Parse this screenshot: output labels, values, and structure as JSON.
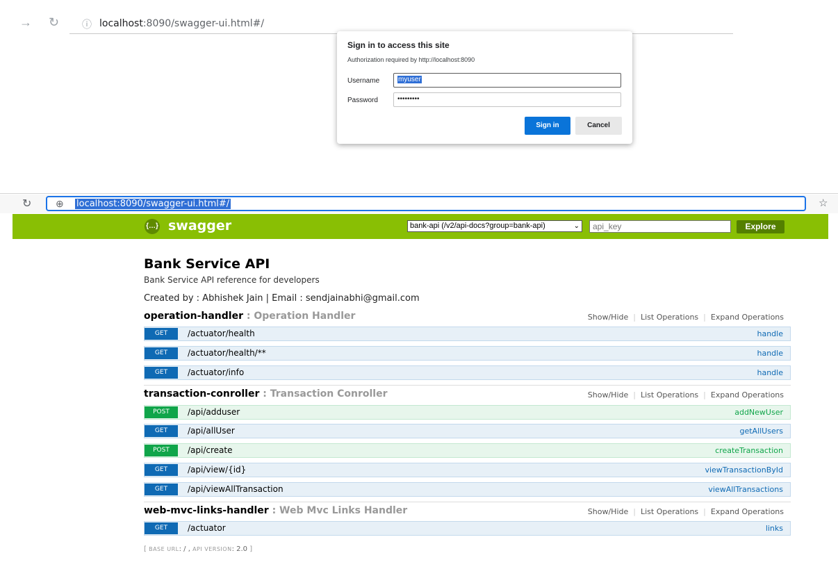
{
  "browser_top": {
    "url_host": "localhost",
    "url_path": ":8090/swagger-ui.html#/"
  },
  "dialog": {
    "title": "Sign in to access this site",
    "subtitle": "Authorization required by http://localhost:8090",
    "username_label": "Username",
    "username_value": "myuser",
    "password_label": "Password",
    "password_value": "•••••••••",
    "signin_label": "Sign in",
    "cancel_label": "Cancel"
  },
  "browser_bottom": {
    "url": "localhost:8090/swagger-ui.html#/"
  },
  "swagger": {
    "title": "swagger",
    "logo_text": "{…}",
    "spec_selected": "bank-api (/v2/api-docs?group=bank-api)",
    "api_key_placeholder": "api_key",
    "explore_label": "Explore"
  },
  "api": {
    "title": "Bank Service API",
    "description": "Bank Service API reference for developers",
    "created": "Created by : Abhishek Jain | Email : sendjainabhi@gmail.com"
  },
  "group_ops": {
    "show_hide": "Show/Hide",
    "list_operations": "List Operations",
    "expand_operations": "Expand Operations"
  },
  "groups": [
    {
      "name": "operation-handler",
      "desc": " : Operation Handler",
      "operations": [
        {
          "method": "GET",
          "path": "/actuator/health",
          "nickname": "handle"
        },
        {
          "method": "GET",
          "path": "/actuator/health/**",
          "nickname": "handle"
        },
        {
          "method": "GET",
          "path": "/actuator/info",
          "nickname": "handle"
        }
      ]
    },
    {
      "name": "transaction-conroller",
      "desc": " : Transaction Conroller",
      "operations": [
        {
          "method": "POST",
          "path": "/api/adduser",
          "nickname": "addNewUser"
        },
        {
          "method": "GET",
          "path": "/api/allUser",
          "nickname": "getAllUsers"
        },
        {
          "method": "POST",
          "path": "/api/create",
          "nickname": "createTransaction"
        },
        {
          "method": "GET",
          "path": "/api/view/{id}",
          "nickname": "viewTransactionById"
        },
        {
          "method": "GET",
          "path": "/api/viewAllTransaction",
          "nickname": "viewAllTransactions"
        }
      ]
    },
    {
      "name": "web-mvc-links-handler",
      "desc": " : Web Mvc Links Handler",
      "operations": [
        {
          "method": "GET",
          "path": "/actuator",
          "nickname": "links"
        }
      ]
    }
  ],
  "footer": {
    "open": "[ ",
    "base_url_label": "BASE URL",
    "base_url": ": / , ",
    "api_version_label": "API VERSION",
    "api_version": ": 2.0",
    "close": " ]"
  },
  "colors": {
    "swagger_green": "#89bf04",
    "get_blue": "#0f6ab4",
    "post_green": "#10a54a",
    "signin_blue": "#0a74d9"
  }
}
